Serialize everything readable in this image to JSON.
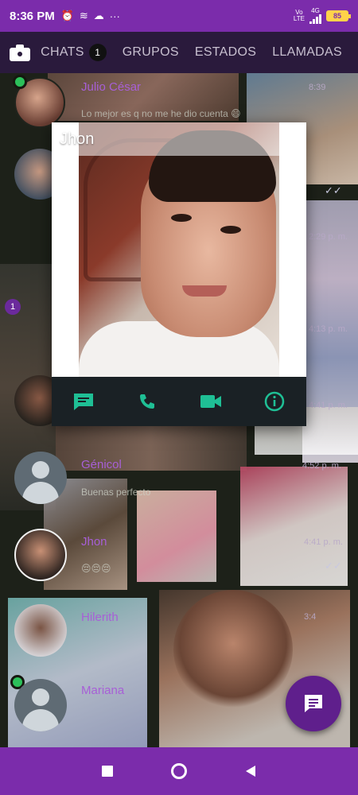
{
  "status_bar": {
    "time": "8:36 PM",
    "icons": [
      "alarm-icon",
      "data-saver-icon",
      "cloud-icon",
      "more-dots-icon"
    ],
    "network_label_1": "Vo",
    "network_label_2": "LTE",
    "network_type": "4G",
    "battery_level": "85",
    "battery_color": "#ffd24a"
  },
  "tabs": {
    "camera_icon": "camera-icon",
    "items": [
      {
        "label": "CHATS",
        "count": "1"
      },
      {
        "label": "GRUPOS"
      },
      {
        "label": "ESTADOS"
      },
      {
        "label": "LLAMADAS"
      }
    ]
  },
  "chat_list": {
    "items": [
      {
        "name": "Julio César",
        "preview": "Lo mejor es q no me he dio cuenta 😄"
      },
      {
        "time": "8:39"
      },
      {
        "time": "2:29 p. m."
      },
      {
        "time": "4:13 p. m."
      },
      {
        "time": "4:41 p. m."
      },
      {
        "name": "Génicol",
        "preview": "Buenas perfecto",
        "time": "4:52 p. m."
      },
      {
        "name": "Jhon",
        "preview": "😔😔😔",
        "time": "4:41 p. m."
      },
      {
        "name": "Hilerith",
        "time": "3:4"
      },
      {
        "name": "Mariana"
      }
    ],
    "unread_badge": "1"
  },
  "profile_popup": {
    "name": "Jhon",
    "actions": [
      {
        "icon": "message-icon"
      },
      {
        "icon": "phone-icon"
      },
      {
        "icon": "video-call-icon"
      },
      {
        "icon": "info-icon"
      }
    ],
    "accent_color": "#1fbf95"
  },
  "fab": {
    "icon": "new-chat-icon"
  },
  "colors": {
    "brand_purple": "#7b2cab",
    "header_dark": "#2a1a3c",
    "name_purple": "#a75fd6",
    "online_green": "#2cc05a"
  },
  "nav": {
    "icons": [
      "recents-square-icon",
      "home-circle-icon",
      "back-triangle-icon"
    ]
  }
}
